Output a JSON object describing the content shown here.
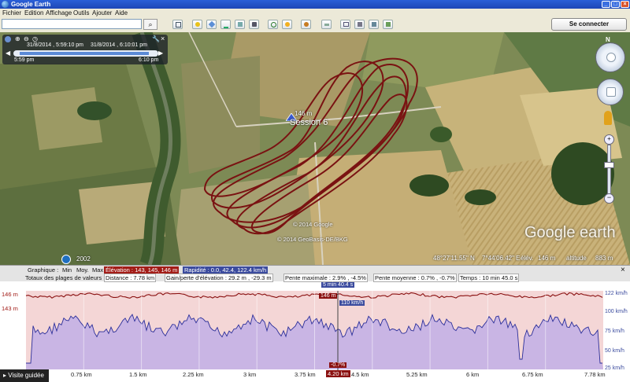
{
  "window": {
    "title": "Google Earth"
  },
  "menu": [
    "Fichier",
    "Edition",
    "Affichage",
    "Outils",
    "Ajouter",
    "Aide"
  ],
  "toolbar": {
    "search_value": "",
    "connect_label": "Se connecter"
  },
  "timeslider": {
    "start_date": "31/8/2014 , 5:59:10 pm",
    "end_date": "31/8/2014 , 6:10:01 pm",
    "start_time": "5:59 pm",
    "end_time": "6:10 pm"
  },
  "map": {
    "placemark_alt": "146 m",
    "placemark_label": "Session 6",
    "copyright_1": "© 2014 Google",
    "copyright_2": "© 2014 GeoBasis-DE/BKG",
    "logo_text": "Google earth",
    "year": "2002",
    "compass_north": "N",
    "coords": {
      "lat": "48°27'11.55\" N",
      "lon": "7°44'06.42\" E",
      "elev_label": "élév.",
      "elev": "146 m",
      "alt_label": "altitude",
      "alt": "883 m"
    }
  },
  "profile": {
    "graph_label": "Graphique :",
    "min_label": "Min",
    "avg_label": "Moy.",
    "max_label": "Max",
    "elevation_stat": "Élévation : 143, 145, 146 m",
    "speed_stat": "Rapidité : 0.0, 42.4, 122.4 km/h",
    "totals_label": "Totaux des plages de valeurs :",
    "distance": "Distance : 7.78 km",
    "gain": "Gain/perte d'élévation : 29.2 m , -29.3 m",
    "max_slope": "Pente maximale : 2.9% , -4.5%",
    "avg_slope": "Pente moyenne : 0.7% , -0.7%",
    "time": "Temps : 10 min 45.0 s",
    "y_left": [
      "146 m",
      "143 m"
    ],
    "y_right": [
      "122 km/h",
      "100 km/h",
      "75 km/h",
      "50 km/h",
      "25 km/h"
    ],
    "x_ticks": [
      "0.75 km",
      "1.5 km",
      "2.25 km",
      "3 km",
      "3.75 km",
      "4.5 km",
      "5.25 km",
      "6 km",
      "6.75 km",
      "7.78 km"
    ],
    "cursor_time": "5 min 40.4 s",
    "cursor_elev": "146 m",
    "cursor_speed": "110 km/h",
    "cursor_slope": "-0.7%",
    "cursor_dist": "4.20 km",
    "tour_label": "Visite guidée"
  }
}
